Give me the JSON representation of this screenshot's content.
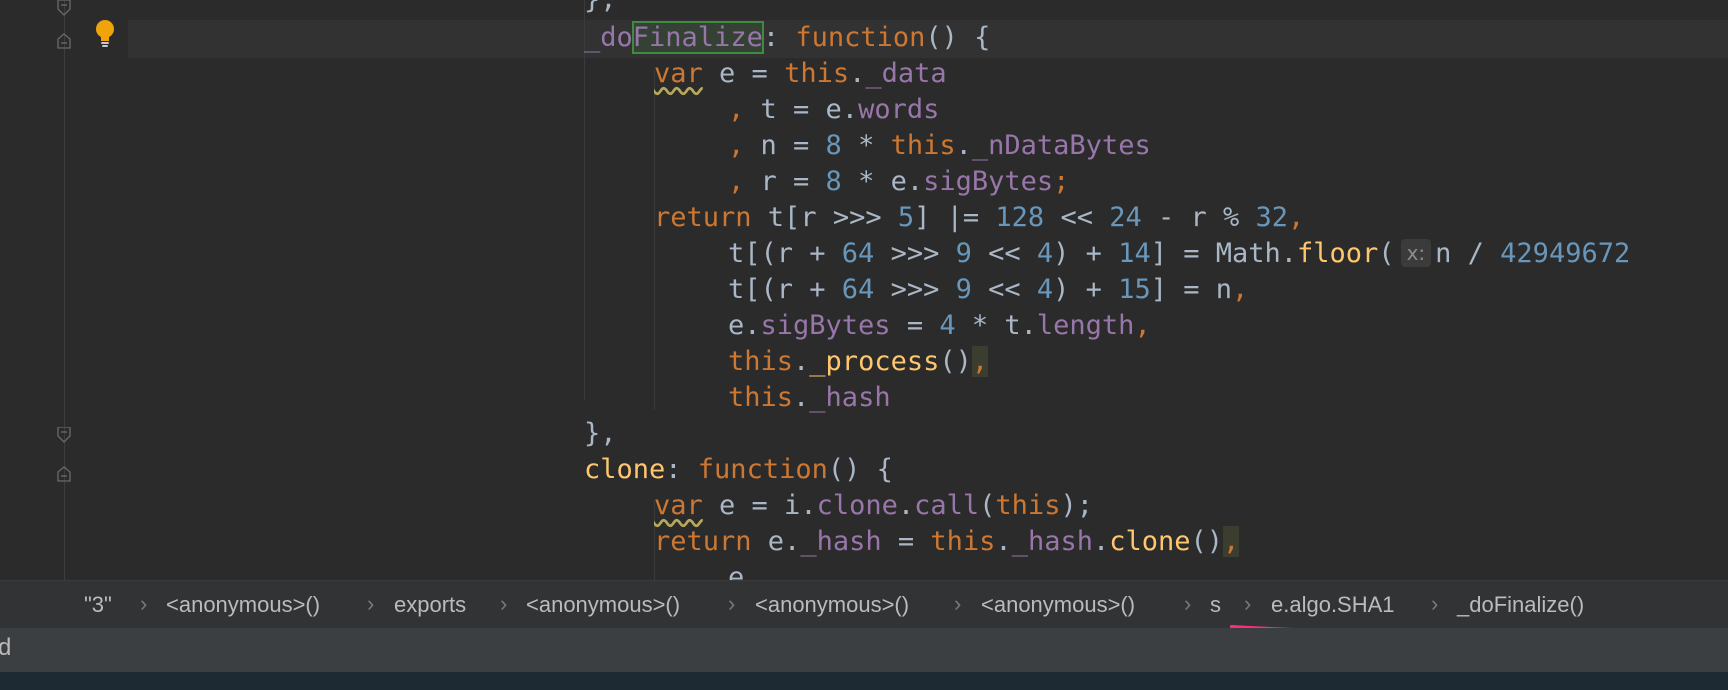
{
  "code_lines": [
    {
      "tokens": [
        {
          "t": "},",
          "c": "txt"
        }
      ]
    },
    {
      "tokens": [
        {
          "t": "_do",
          "c": "prop"
        },
        {
          "t": "Finalize",
          "c": "prop"
        },
        {
          "t": ": ",
          "c": "txt"
        },
        {
          "t": "function",
          "c": "kw"
        },
        {
          "t": "() {",
          "c": "txt"
        }
      ]
    },
    {
      "tokens": [
        {
          "t": "var",
          "c": "kw"
        },
        {
          "t": " e = ",
          "c": "txt"
        },
        {
          "t": "this",
          "c": "kw"
        },
        {
          "t": ".",
          "c": "txt"
        },
        {
          "t": "_data",
          "c": "prop"
        }
      ]
    },
    {
      "tokens": [
        {
          "t": ", ",
          "c": "kw"
        },
        {
          "t": "t = e.",
          "c": "txt"
        },
        {
          "t": "words",
          "c": "prop"
        }
      ]
    },
    {
      "tokens": [
        {
          "t": ", ",
          "c": "kw"
        },
        {
          "t": "n = ",
          "c": "txt"
        },
        {
          "t": "8",
          "c": "num"
        },
        {
          "t": " * ",
          "c": "txt"
        },
        {
          "t": "this",
          "c": "kw"
        },
        {
          "t": ".",
          "c": "txt"
        },
        {
          "t": "_nDataBytes",
          "c": "prop"
        }
      ]
    },
    {
      "tokens": [
        {
          "t": ", ",
          "c": "kw"
        },
        {
          "t": "r = ",
          "c": "txt"
        },
        {
          "t": "8",
          "c": "num"
        },
        {
          "t": " * e.",
          "c": "txt"
        },
        {
          "t": "sigBytes",
          "c": "prop"
        },
        {
          "t": ";",
          "c": "kw"
        }
      ]
    },
    {
      "tokens": [
        {
          "t": "return",
          "c": "kw"
        },
        {
          "t": " t[r >>> ",
          "c": "txt"
        },
        {
          "t": "5",
          "c": "num"
        },
        {
          "t": "] |= ",
          "c": "txt"
        },
        {
          "t": "128",
          "c": "num"
        },
        {
          "t": " << ",
          "c": "txt"
        },
        {
          "t": "24",
          "c": "num"
        },
        {
          "t": " - r % ",
          "c": "txt"
        },
        {
          "t": "32",
          "c": "num"
        },
        {
          "t": ",",
          "c": "kw"
        }
      ]
    },
    {
      "tokens": [
        {
          "t": "t[(r + ",
          "c": "txt"
        },
        {
          "t": "64",
          "c": "num"
        },
        {
          "t": " >>> ",
          "c": "txt"
        },
        {
          "t": "9",
          "c": "num"
        },
        {
          "t": " << ",
          "c": "txt"
        },
        {
          "t": "4",
          "c": "num"
        },
        {
          "t": ") + ",
          "c": "txt"
        },
        {
          "t": "14",
          "c": "num"
        },
        {
          "t": "] = Math.",
          "c": "txt"
        },
        {
          "t": "floor",
          "c": "fn"
        },
        {
          "t": "(",
          "c": "txt"
        },
        {
          "t": "x:",
          "c": "hint"
        },
        {
          "t": "n / ",
          "c": "txt"
        },
        {
          "t": "42949672",
          "c": "num"
        }
      ]
    },
    {
      "tokens": [
        {
          "t": "t[(r + ",
          "c": "txt"
        },
        {
          "t": "64",
          "c": "num"
        },
        {
          "t": " >>> ",
          "c": "txt"
        },
        {
          "t": "9",
          "c": "num"
        },
        {
          "t": " << ",
          "c": "txt"
        },
        {
          "t": "4",
          "c": "num"
        },
        {
          "t": ") + ",
          "c": "txt"
        },
        {
          "t": "15",
          "c": "num"
        },
        {
          "t": "] = n",
          "c": "txt"
        },
        {
          "t": ",",
          "c": "kw"
        }
      ]
    },
    {
      "tokens": [
        {
          "t": "e.",
          "c": "txt"
        },
        {
          "t": "sigBytes",
          "c": "prop"
        },
        {
          "t": " = ",
          "c": "txt"
        },
        {
          "t": "4",
          "c": "num"
        },
        {
          "t": " * t.",
          "c": "txt"
        },
        {
          "t": "length",
          "c": "prop"
        },
        {
          "t": ",",
          "c": "kw"
        }
      ]
    },
    {
      "tokens": [
        {
          "t": "this",
          "c": "kw"
        },
        {
          "t": ".",
          "c": "txt"
        },
        {
          "t": "_process",
          "c": "fn"
        },
        {
          "t": "()",
          "c": "txt"
        },
        {
          "t": ",",
          "c": "kw"
        }
      ]
    },
    {
      "tokens": [
        {
          "t": "this",
          "c": "kw"
        },
        {
          "t": ".",
          "c": "txt"
        },
        {
          "t": "_hash",
          "c": "prop"
        }
      ]
    },
    {
      "tokens": [
        {
          "t": "},",
          "c": "txt"
        }
      ]
    },
    {
      "tokens": [
        {
          "t": "clone",
          "c": "fn"
        },
        {
          "t": ": ",
          "c": "txt"
        },
        {
          "t": "function",
          "c": "kw"
        },
        {
          "t": "() {",
          "c": "txt"
        }
      ]
    },
    {
      "tokens": [
        {
          "t": "var",
          "c": "kw"
        },
        {
          "t": " e = i.",
          "c": "txt"
        },
        {
          "t": "clone",
          "c": "prop"
        },
        {
          "t": ".",
          "c": "txt"
        },
        {
          "t": "call",
          "c": "prop"
        },
        {
          "t": "(",
          "c": "txt"
        },
        {
          "t": "this",
          "c": "kw"
        },
        {
          "t": ");",
          "c": "txt"
        }
      ]
    },
    {
      "tokens": [
        {
          "t": "return",
          "c": "kw"
        },
        {
          "t": " e.",
          "c": "txt"
        },
        {
          "t": "_hash",
          "c": "prop"
        },
        {
          "t": " = ",
          "c": "txt"
        },
        {
          "t": "this",
          "c": "kw"
        },
        {
          "t": ".",
          "c": "txt"
        },
        {
          "t": "_hash",
          "c": "prop"
        },
        {
          "t": ".",
          "c": "txt"
        },
        {
          "t": "clone",
          "c": "fn"
        },
        {
          "t": "()",
          "c": "txt"
        },
        {
          "t": ",",
          "c": "kw"
        }
      ]
    },
    {
      "tokens": [
        {
          "t": "e",
          "c": "txt"
        }
      ]
    }
  ],
  "breadcrumb": [
    "\"3\"",
    "<anonymous>()",
    "exports",
    "<anonymous>()",
    "<anonymous>()",
    "<anonymous>()",
    "s",
    "e.algo.SHA1",
    "_doFinalize()"
  ],
  "breadcrumb_separator": "›",
  "status_text": "d",
  "colors": {
    "background": "#2b2b2b",
    "keyword": "#cc7832",
    "function": "#ffc66d",
    "property": "#9876aa",
    "number": "#6897bb",
    "text": "#a9b7c6",
    "annotation_marker": "#ff2d73",
    "bulb": "#f0a30a"
  },
  "icons": {
    "intention": "lightbulb-icon",
    "fold": "fold-marker-icon"
  }
}
